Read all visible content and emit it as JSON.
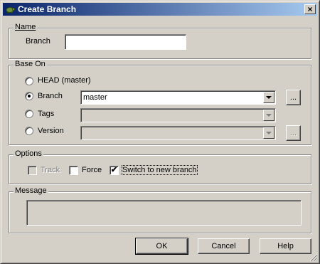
{
  "window": {
    "title": "Create Branch",
    "close_glyph": "×"
  },
  "name_group": {
    "legend": "Name",
    "branch_label": "Branch",
    "branch_value": ""
  },
  "base_on": {
    "legend": "Base On",
    "head_label": "HEAD (master)",
    "branch_label": "Branch",
    "branch_value": "master",
    "tags_label": "Tags",
    "tags_value": "",
    "version_label": "Version",
    "version_value": "",
    "browse_label": "...",
    "selected": "Branch"
  },
  "options": {
    "legend": "Options",
    "track_label": "Track",
    "track_checked": false,
    "force_label": "Force",
    "force_checked": false,
    "switch_label": "Switch to new branch",
    "switch_checked": true,
    "check_glyph": "✔"
  },
  "message": {
    "legend": "Message",
    "value": ""
  },
  "buttons": {
    "ok": "OK",
    "cancel": "Cancel",
    "help": "Help"
  },
  "icons": {
    "title_icon": "tortoise-icon",
    "resize": "resize-grip-icon"
  }
}
